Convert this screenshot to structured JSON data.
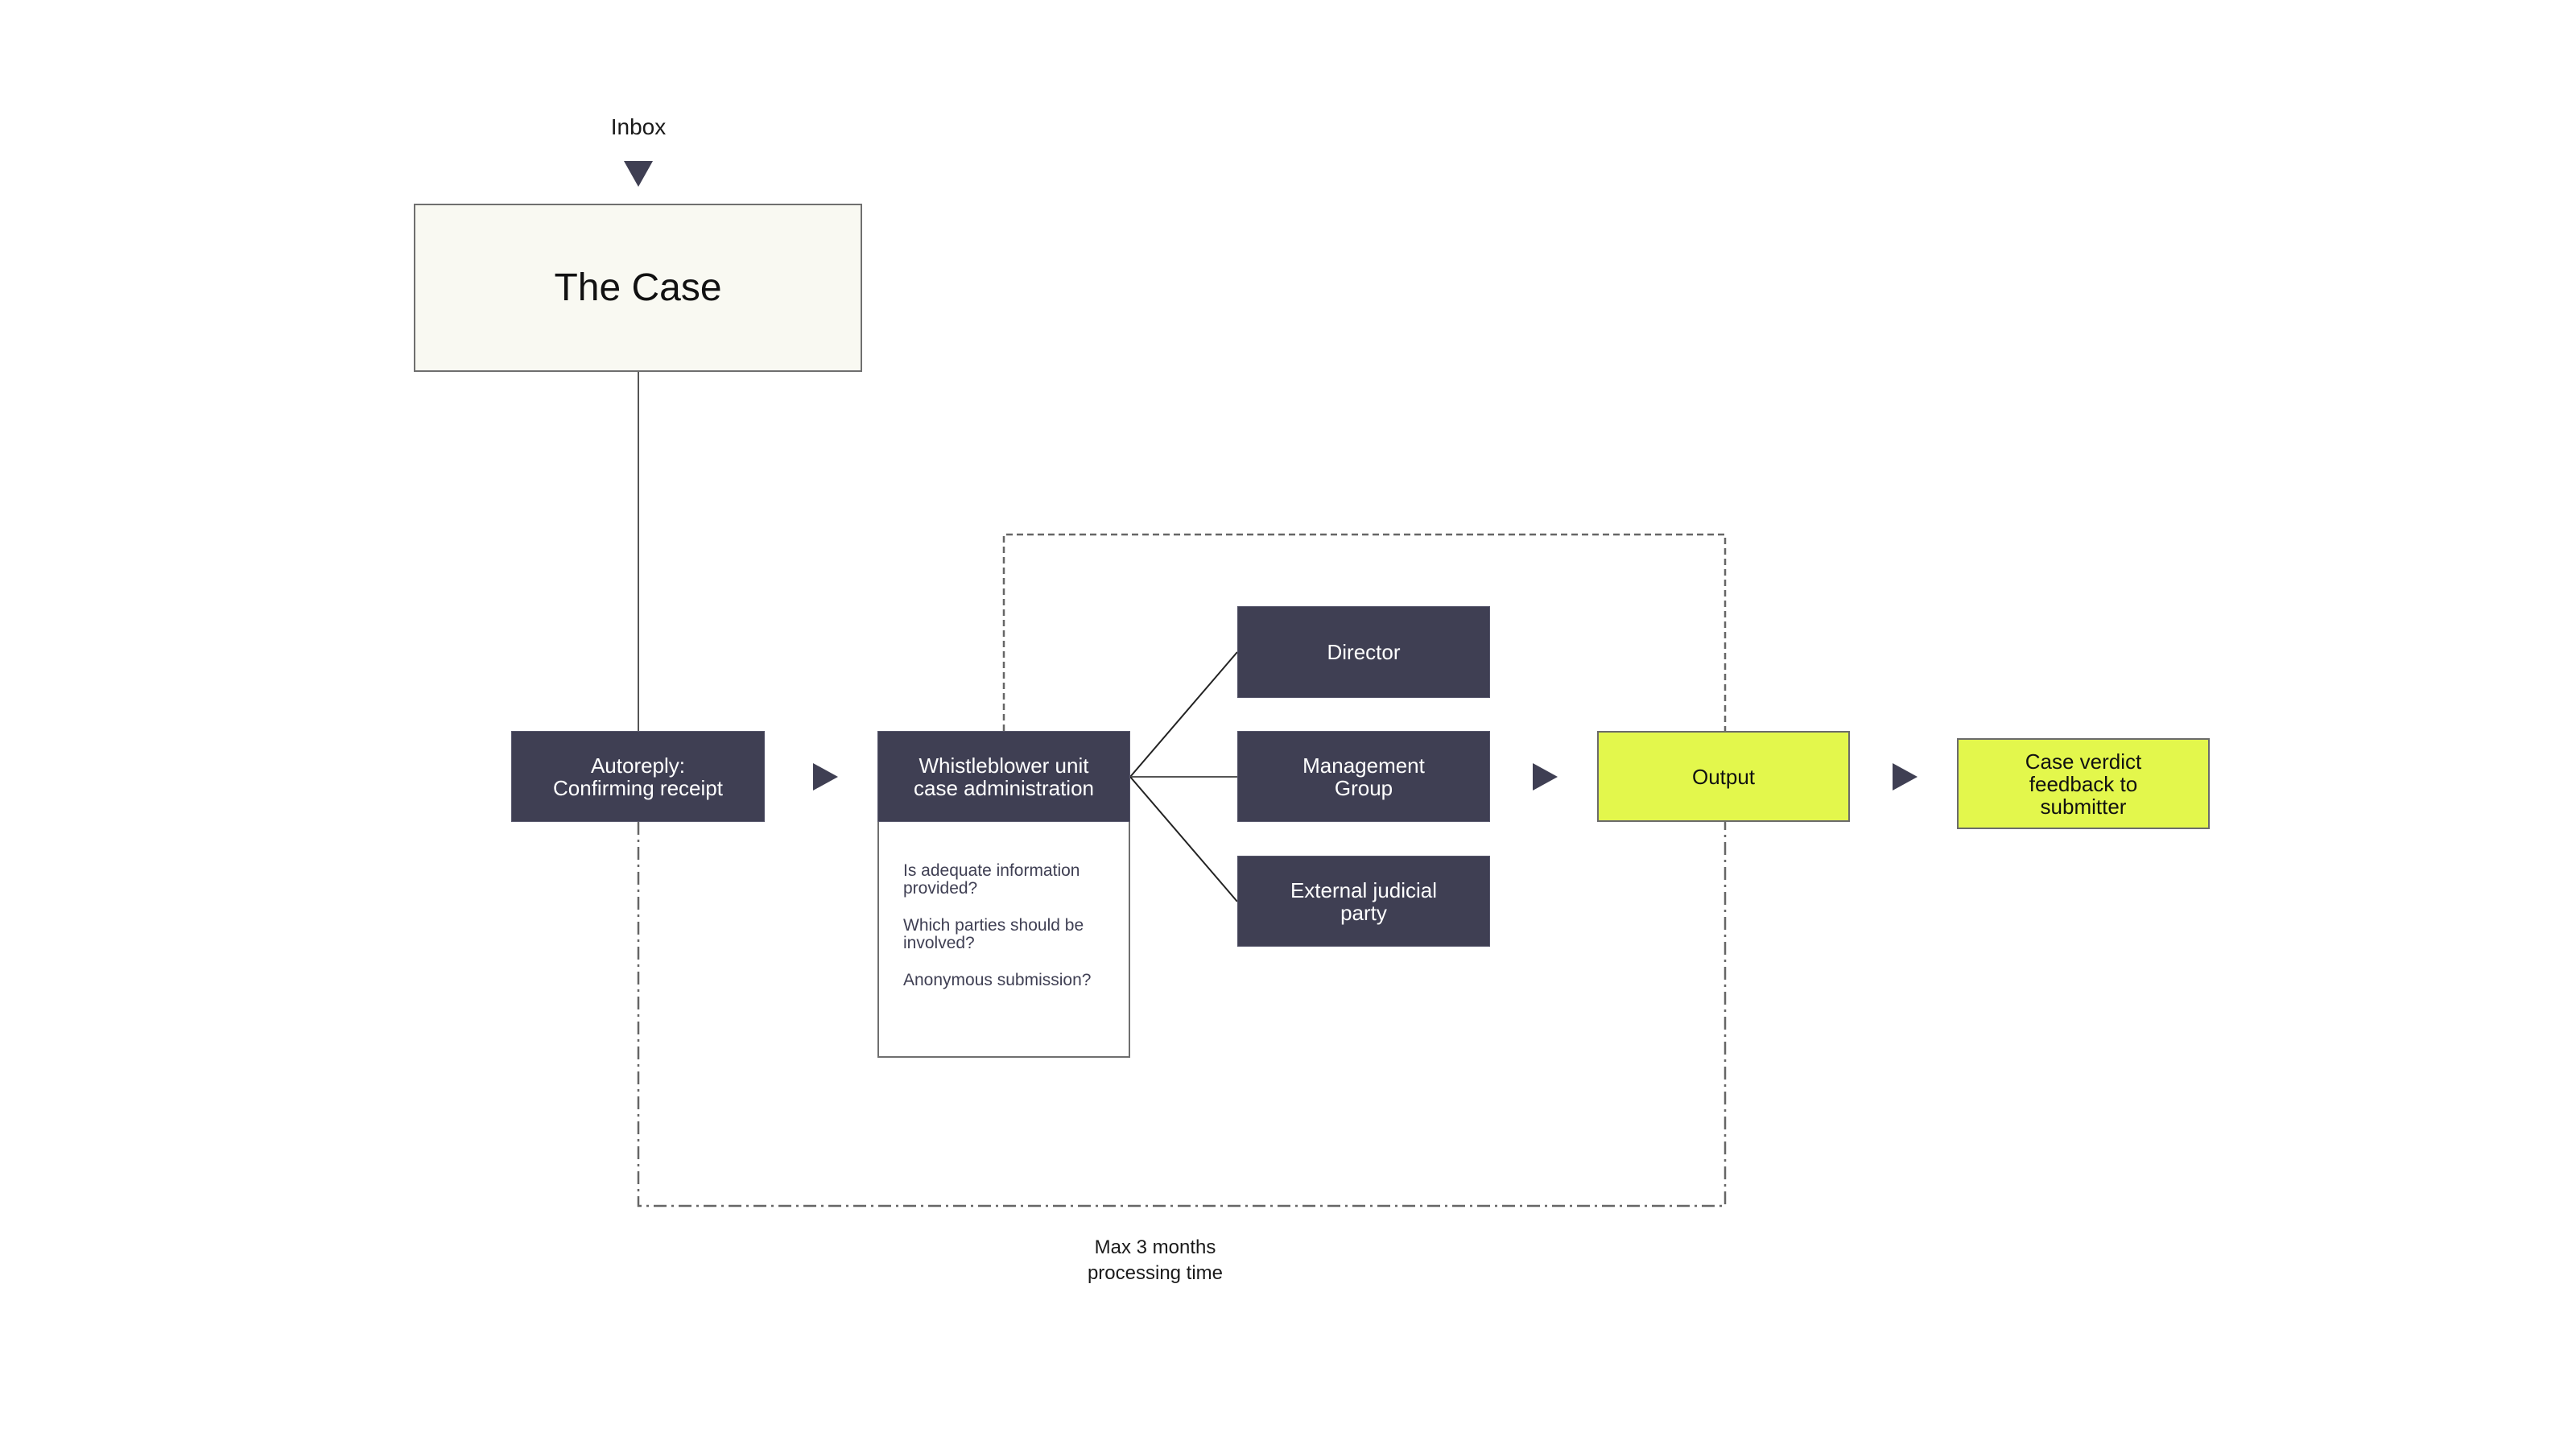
{
  "diagram": {
    "inbox_label": "Inbox",
    "case_title": "The Case",
    "autoreply": "Autoreply:\nConfirming receipt",
    "whistleblower": "Whistleblower unit case administration",
    "questions": [
      "Is adequate information provided?",
      "Which parties should be involved?",
      "Anonymous submission?"
    ],
    "parties": [
      "Director",
      "Management Group",
      "External judicial party"
    ],
    "output": "Output",
    "verdict": "Case verdict feedback to submitter",
    "processing_note_line1": "Max 3 months",
    "processing_note_line2": "processing time"
  },
  "colors": {
    "dark_box": "#3f3f53",
    "accent_lime": "#e3f74c",
    "case_box": "#f9f9f2"
  }
}
